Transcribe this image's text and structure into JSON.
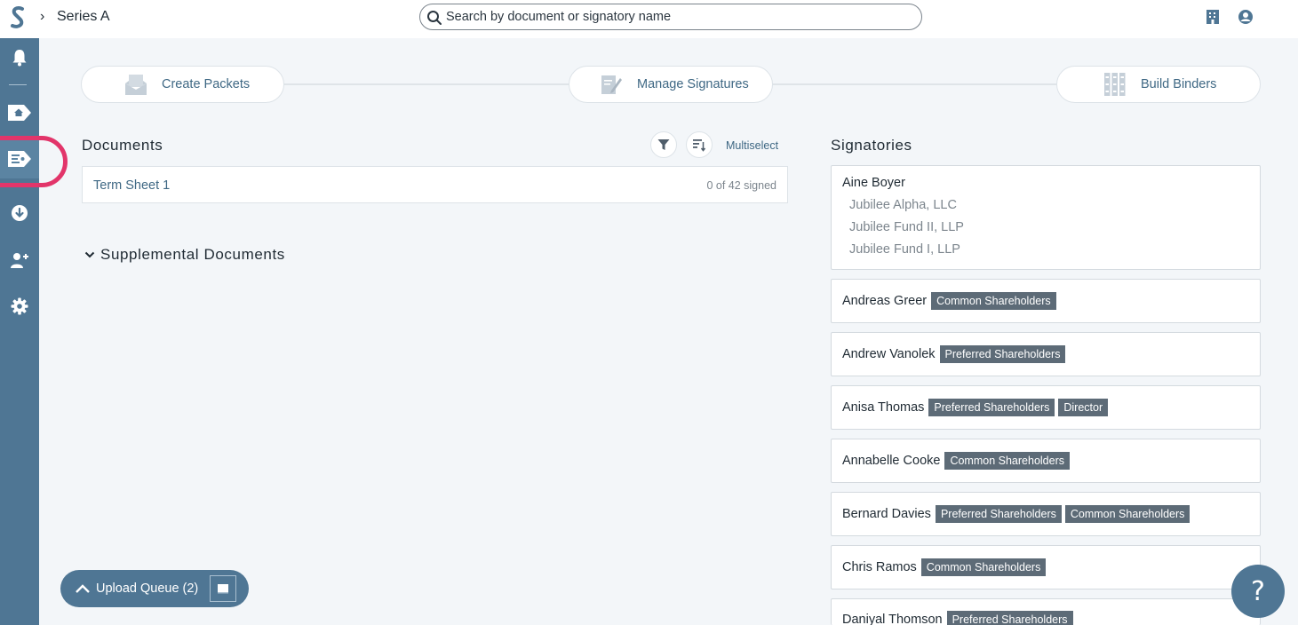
{
  "header": {
    "breadcrumb_chevron": "›",
    "title": "Series A",
    "search_placeholder": "Search by document or signatory name",
    "logo_icon": "s-logo",
    "right_icons": [
      "building-icon",
      "user-circle-icon"
    ]
  },
  "sidebar": {
    "items": [
      {
        "icon": "bell-icon"
      },
      {
        "icon": "home-icon"
      },
      {
        "icon": "documents-icon",
        "active": true
      },
      {
        "icon": "download-icon"
      },
      {
        "icon": "add-user-icon"
      },
      {
        "icon": "gear-icon"
      }
    ],
    "highlight_color": "#e2356a"
  },
  "steps": [
    {
      "label": "Create Packets",
      "icon": "packet-icon"
    },
    {
      "label": "Manage Signatures",
      "icon": "signature-icon"
    },
    {
      "label": "Build Binders",
      "icon": "binder-icon"
    }
  ],
  "documents": {
    "title": "Documents",
    "multiselect_label": "Multiselect",
    "items": [
      {
        "name": "Term Sheet 1",
        "status": "0 of 42 signed"
      }
    ],
    "supplemental_label": "Supplemental Documents"
  },
  "signatories": {
    "title": "Signatories",
    "items": [
      {
        "name": "Aine Boyer",
        "tags": [],
        "entities": [
          "Jubilee Alpha, LLC",
          "Jubilee Fund II, LLP",
          "Jubilee Fund I, LLP"
        ]
      },
      {
        "name": "Andreas Greer",
        "tags": [
          "Common Shareholders"
        ]
      },
      {
        "name": "Andrew Vanolek",
        "tags": [
          "Preferred Shareholders"
        ]
      },
      {
        "name": "Anisa Thomas",
        "tags": [
          "Preferred Shareholders",
          "Director"
        ]
      },
      {
        "name": "Annabelle Cooke",
        "tags": [
          "Common Shareholders"
        ]
      },
      {
        "name": "Bernard Davies",
        "tags": [
          "Preferred Shareholders",
          "Common Shareholders"
        ]
      },
      {
        "name": "Chris Ramos",
        "tags": [
          "Common Shareholders"
        ]
      },
      {
        "name": "Daniyal Thomson",
        "tags": [
          "Preferred Shareholders"
        ]
      }
    ]
  },
  "upload_queue": {
    "label": "Upload Queue (2)"
  },
  "help": {
    "label": "?"
  },
  "colors": {
    "accent": "#4f7694",
    "link": "#3f6884",
    "tag_bg": "#5d6b77"
  }
}
